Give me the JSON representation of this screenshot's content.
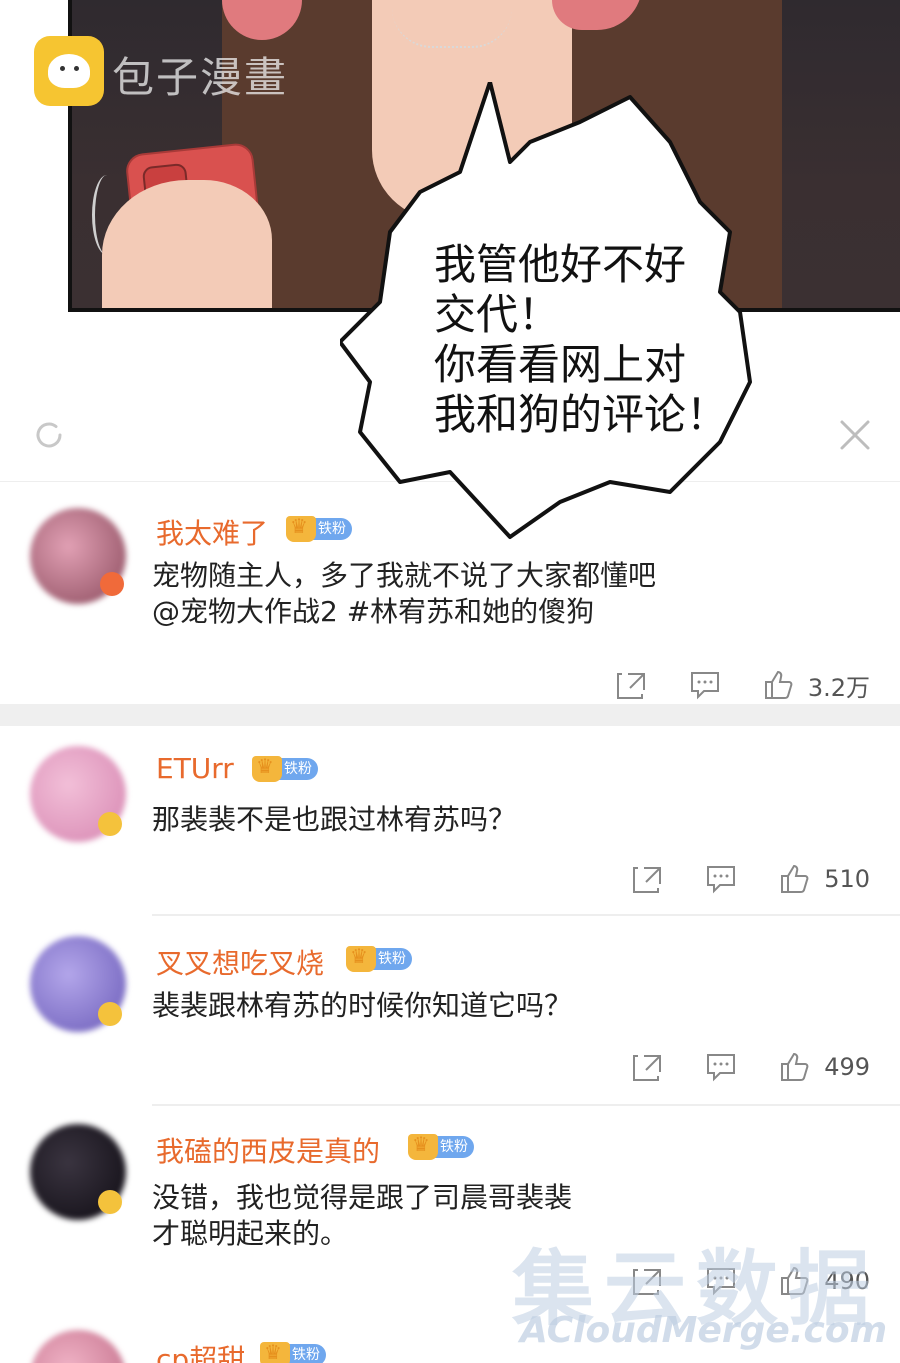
{
  "watermark": {
    "brand": "包子漫畫",
    "bottom_big": "集云数据",
    "bottom_url": "ACloudMerge.com"
  },
  "bubble": {
    "lines": [
      "我管他好不好",
      "交代！",
      "你看看网上对",
      "我和狗的评论！"
    ]
  },
  "comments": [
    {
      "username": "我太难了",
      "fan_label": "铁粉",
      "lines": [
        "宠物随主人，多了我就不说了大家都懂吧",
        "@宠物大作战2 #林宥苏和她的傻狗"
      ],
      "likes": "3.2万",
      "avatar_color": "#c87a8c"
    },
    {
      "username": "ETUrr",
      "fan_label": "铁粉",
      "lines": [
        "那裴裴不是也跟过林宥苏吗？"
      ],
      "likes": "510",
      "avatar_color": "#e8a6c6"
    },
    {
      "username": "叉叉想吃叉烧",
      "fan_label": "铁粉",
      "lines": [
        "裴裴跟林宥苏的时候你知道它吗？"
      ],
      "likes": "499",
      "avatar_color": "#8a7bd0"
    },
    {
      "username": "我磕的西皮是真的",
      "fan_label": "铁粉",
      "lines": [
        "没错，我也觉得是跟了司晨哥裴裴",
        "才聪明起来的。"
      ],
      "likes": "490",
      "avatar_color": "#1e1a24"
    },
    {
      "username": "cp超甜",
      "fan_label": "铁粉",
      "avatar_color": "#d98aa5"
    }
  ],
  "colors": {
    "username": "#e86a2d",
    "fan_badge": "#6fa7ee",
    "crown": "#f4b63c"
  }
}
